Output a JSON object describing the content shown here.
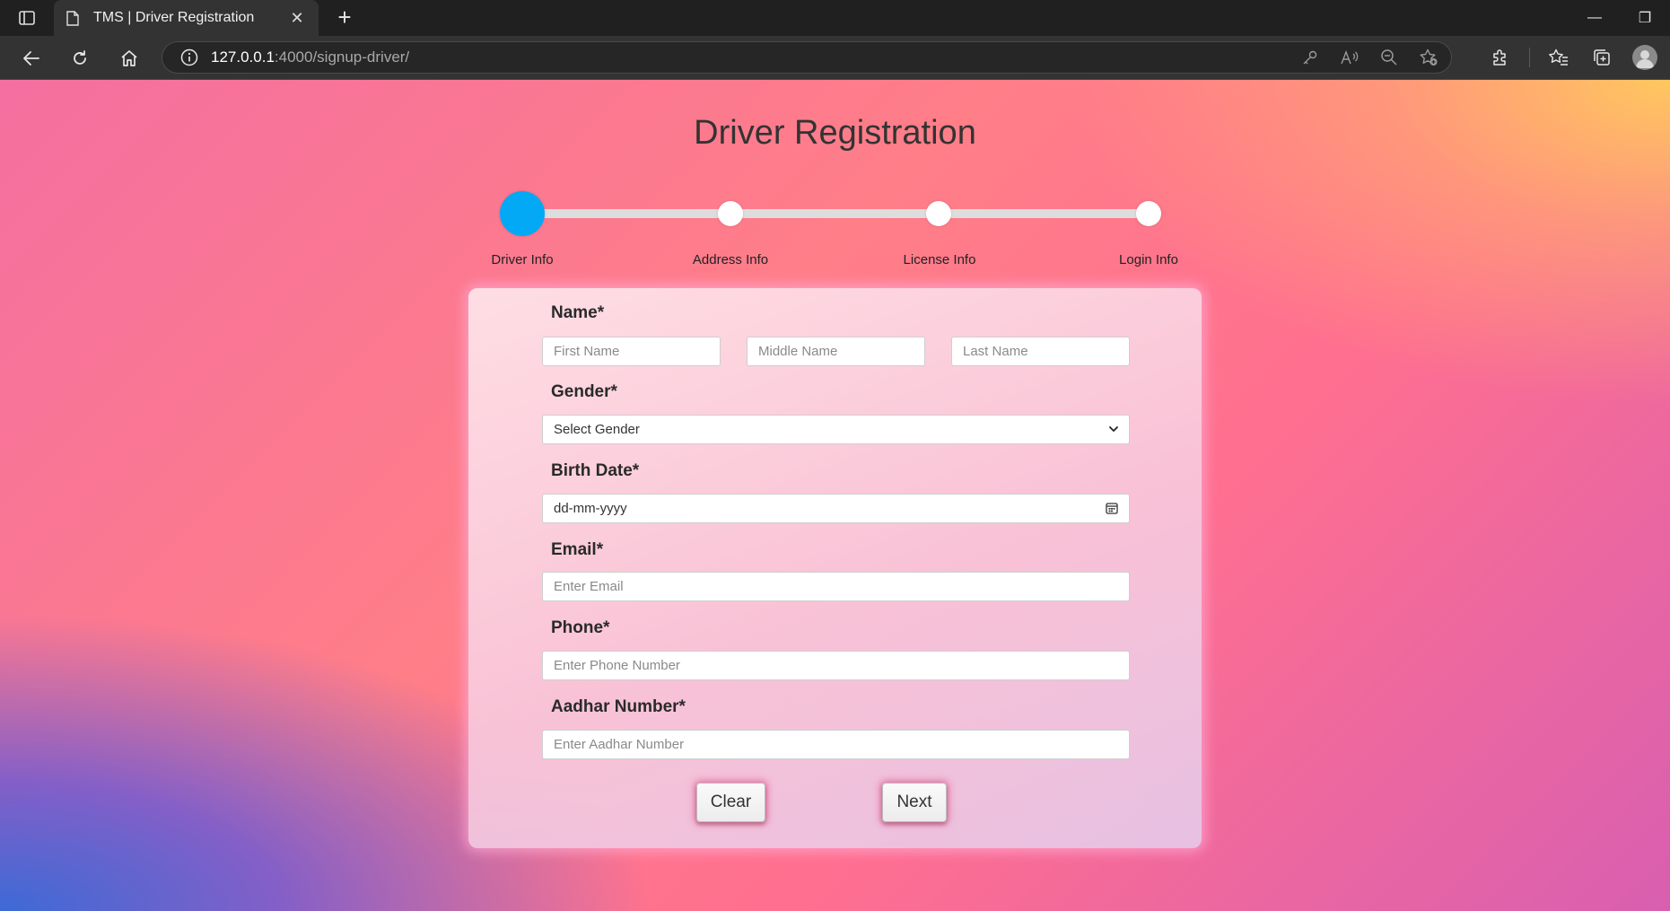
{
  "browser": {
    "tab_title": "TMS | Driver Registration",
    "tab_close": "✕",
    "new_tab": "+",
    "url_host": "127.0.0.1",
    "url_path": ":4000/signup-driver/",
    "window_controls": {
      "minimize": "—",
      "restore": "❐"
    }
  },
  "page": {
    "title": "Driver Registration"
  },
  "stepper": {
    "active_index": 0,
    "steps": [
      {
        "label": "Driver Info"
      },
      {
        "label": "Address Info"
      },
      {
        "label": "License Info"
      },
      {
        "label": "Login Info"
      }
    ]
  },
  "form": {
    "name": {
      "label": "Name*",
      "first_placeholder": "First Name",
      "middle_placeholder": "Middle Name",
      "last_placeholder": "Last Name"
    },
    "gender": {
      "label": "Gender*",
      "selected": "Select Gender"
    },
    "birth_date": {
      "label": "Birth Date*",
      "placeholder": "dd-mm-yyyy"
    },
    "email": {
      "label": "Email*",
      "placeholder": "Enter Email"
    },
    "phone": {
      "label": "Phone*",
      "placeholder": "Enter Phone Number"
    },
    "aadhar": {
      "label": "Aadhar Number*",
      "placeholder": "Enter Aadhar Number"
    },
    "buttons": {
      "clear": "Clear",
      "next": "Next"
    }
  },
  "colors": {
    "active_step": "#03a9f4",
    "step_track": "#dddddd"
  }
}
